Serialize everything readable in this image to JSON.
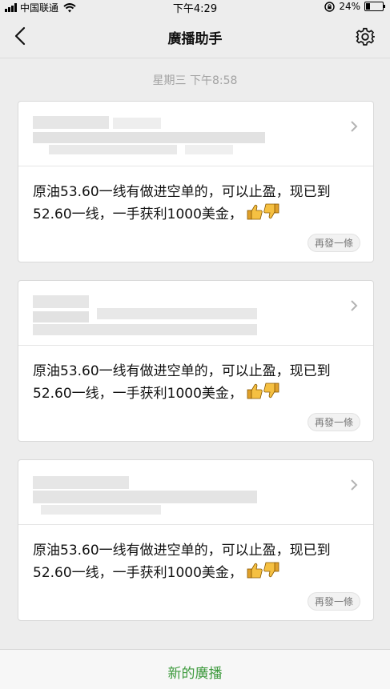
{
  "status_bar": {
    "carrier": "中国联通",
    "time": "下午4:29",
    "battery_percent": "24%",
    "battery_level": 0.24
  },
  "nav": {
    "title": "廣播助手"
  },
  "date_label": "星期三 下午8:58",
  "cards": [
    {
      "message": "原油53.60一线有做进空单的，可以止盈，现已到52.60一线，一手获利1000美金，",
      "resend_label": "再發一條"
    },
    {
      "message": "原油53.60一线有做进空单的，可以止盈，现已到52.60一线，一手获利1000美金，",
      "resend_label": "再發一條"
    },
    {
      "message": "原油53.60一线有做进空单的，可以止盈，现已到52.60一线，一手获利1000美金，",
      "resend_label": "再發一條"
    }
  ],
  "bottom": {
    "new_broadcast_label": "新的廣播"
  },
  "colors": {
    "accent_green": "#3d9a3d",
    "background": "#ededed"
  },
  "icons": [
    "back-chevron-icon",
    "gear-icon",
    "chevron-right-icon",
    "thumbs-up-icon",
    "thumbs-down-icon",
    "wifi-icon",
    "signal-icon",
    "battery-icon",
    "lock-rotation-icon"
  ]
}
